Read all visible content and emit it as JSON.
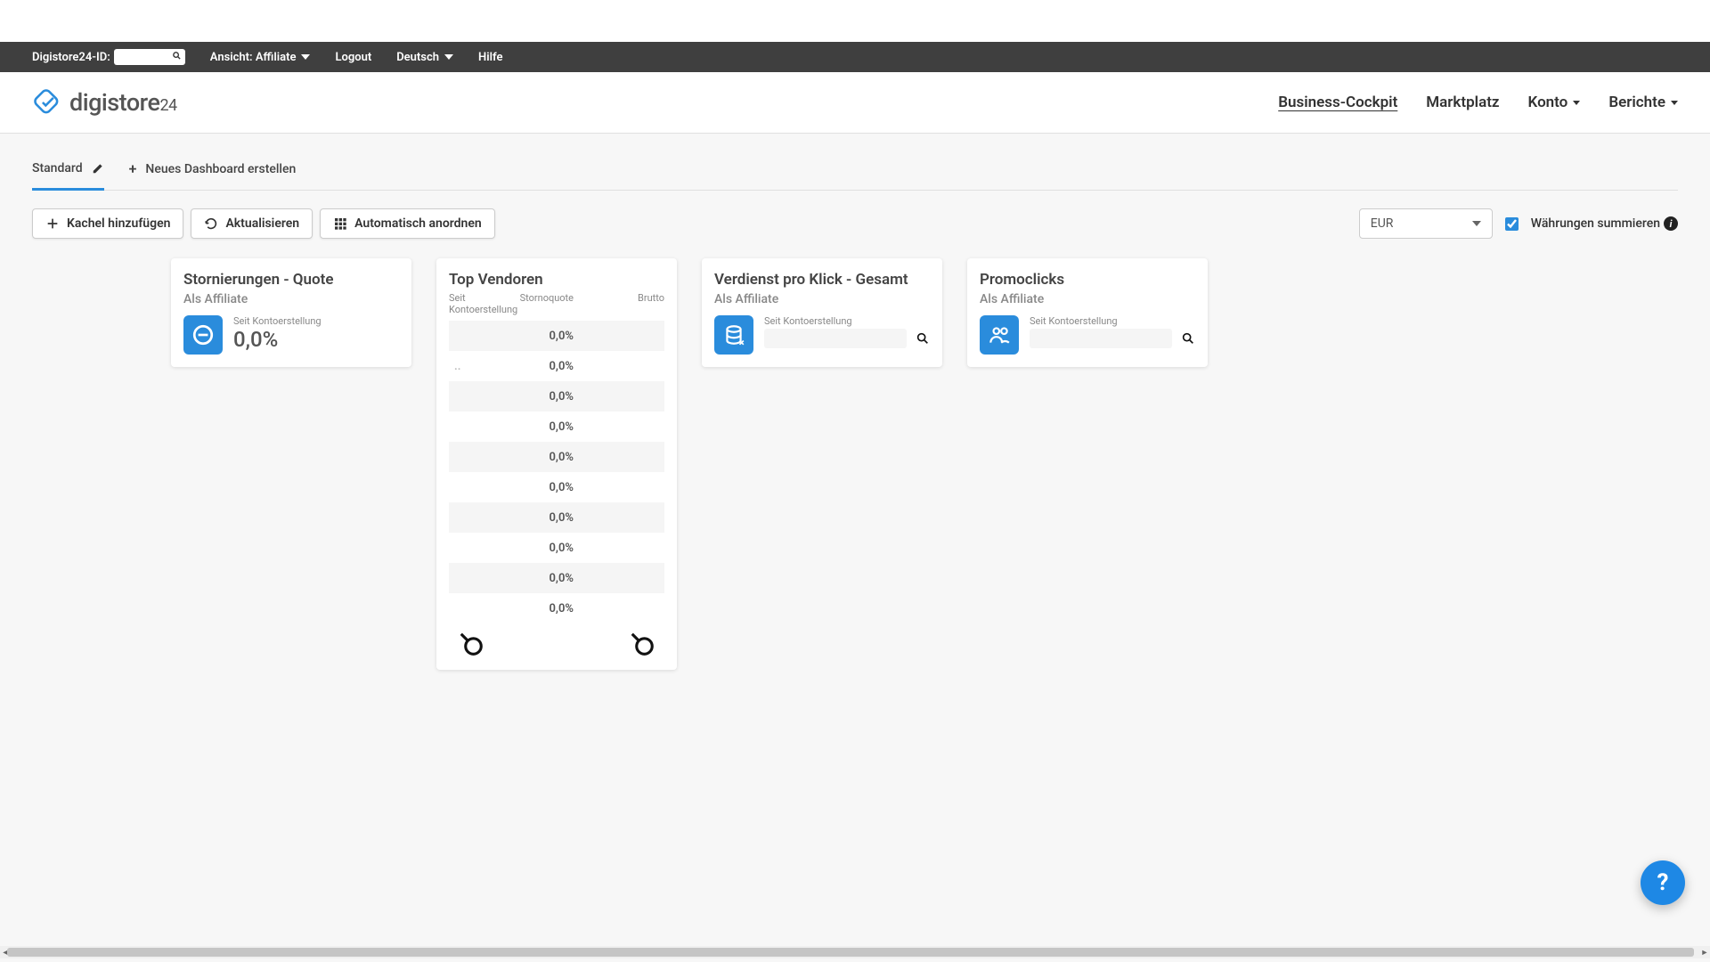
{
  "topbar": {
    "id_label": "Digistore24-ID:",
    "view_label": "Ansicht: Affiliate",
    "logout": "Logout",
    "language": "Deutsch",
    "help": "Hilfe"
  },
  "logo_text": "digistore",
  "logo_suffix": "24",
  "nav": {
    "business": "Business-Cockpit",
    "market": "Marktplatz",
    "account": "Konto",
    "reports": "Berichte"
  },
  "tabs": {
    "standard": "Standard",
    "new_dash": "Neues Dashboard erstellen"
  },
  "toolbar": {
    "add_tile": "Kachel hinzufügen",
    "refresh": "Aktualisieren",
    "auto_arrange": "Automatisch anordnen",
    "currency": "EUR",
    "sum_currencies": "Währungen summieren"
  },
  "cards": {
    "cancel": {
      "title": "Stornierungen - Quote",
      "sub": "Als Affiliate",
      "since": "Seit Kontoerstellung",
      "value": "0,0%"
    },
    "vendors": {
      "title": "Top Vendoren",
      "h1": "Seit Kontoerstellung",
      "h2": "Stornoquote",
      "h3": "Brutto",
      "rows": [
        {
          "c1": "",
          "quote": "0,0%",
          "brutto": ""
        },
        {
          "c1": "..",
          "quote": "0,0%",
          "brutto": ""
        },
        {
          "c1": "",
          "quote": "0,0%",
          "brutto": ""
        },
        {
          "c1": "",
          "quote": "0,0%",
          "brutto": ""
        },
        {
          "c1": "",
          "quote": "0,0%",
          "brutto": ""
        },
        {
          "c1": "",
          "quote": "0,0%",
          "brutto": ""
        },
        {
          "c1": "",
          "quote": "0,0%",
          "brutto": ""
        },
        {
          "c1": "",
          "quote": "0,0%",
          "brutto": ""
        },
        {
          "c1": "",
          "quote": "0,0%",
          "brutto": ""
        },
        {
          "c1": "",
          "quote": "0,0%",
          "brutto": ""
        }
      ]
    },
    "epc": {
      "title": "Verdienst pro Klick - Gesamt",
      "sub": "Als Affiliate",
      "since": "Seit Kontoerstellung"
    },
    "promo": {
      "title": "Promoclicks",
      "sub": "Als Affiliate",
      "since": "Seit Kontoerstellung"
    }
  },
  "help_fab": "?"
}
